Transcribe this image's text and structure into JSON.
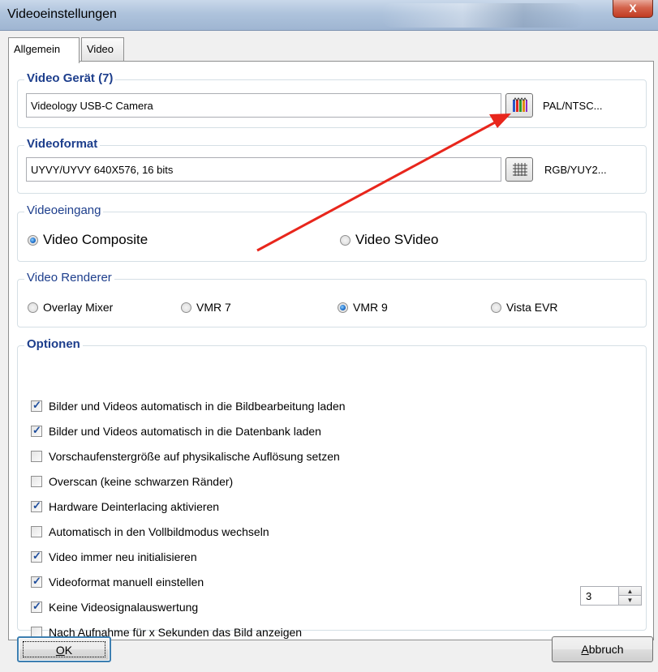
{
  "window": {
    "title": "Videoeinstellungen",
    "close_label": "X"
  },
  "tabs": [
    {
      "label": "Allgemein",
      "active": true
    },
    {
      "label": "Video",
      "active": false
    }
  ],
  "video_device": {
    "title": "Video Gerät (7)",
    "value": "Videology USB-C Camera",
    "button_icon": "color-bars-icon",
    "button_label": "PAL/NTSC..."
  },
  "video_format": {
    "title": "Videoformat",
    "value": "UYVY/UYVY 640X576, 16 bits",
    "button_icon": "grid-icon",
    "button_label": "RGB/YUY2..."
  },
  "video_input": {
    "title": "Videoeingang",
    "options": [
      {
        "label": "Video Composite",
        "selected": true
      },
      {
        "label": "Video SVideo",
        "selected": false
      }
    ]
  },
  "video_renderer": {
    "title": "Video Renderer",
    "options": [
      {
        "label": "Overlay Mixer",
        "selected": false
      },
      {
        "label": "VMR 7",
        "selected": false
      },
      {
        "label": "VMR 9",
        "selected": true
      },
      {
        "label": "Vista EVR",
        "selected": false
      }
    ]
  },
  "options": {
    "title": "Optionen",
    "items": [
      {
        "label": "Bilder und Videos automatisch in die Bildbearbeitung laden",
        "checked": true
      },
      {
        "label": "Bilder und Videos automatisch in die Datenbank laden",
        "checked": true
      },
      {
        "label": "Vorschaufenstergröße auf physikalische Auflösung setzen",
        "checked": false
      },
      {
        "label": "Overscan (keine schwarzen Ränder)",
        "checked": false
      },
      {
        "label": "Hardware Deinterlacing aktivieren",
        "checked": true
      },
      {
        "label": "Automatisch in den Vollbildmodus wechseln",
        "checked": false
      },
      {
        "label": "Video immer neu initialisieren",
        "checked": true
      },
      {
        "label": "Videoformat manuell einstellen",
        "checked": true
      },
      {
        "label": "Keine Videosignalauswertung",
        "checked": true
      },
      {
        "label": "Nach Aufnahme für x Sekunden das Bild anzeigen",
        "checked": false
      }
    ],
    "seconds_value": "3"
  },
  "buttons": {
    "ok_mnemonic": "O",
    "ok_rest": "K",
    "cancel_mnemonic": "A",
    "cancel_rest": "bbruch"
  },
  "colors": {
    "group_title": "#1d3e8c",
    "annotation_arrow": "#e8261c",
    "radio_selected": "#1b6cc8"
  }
}
